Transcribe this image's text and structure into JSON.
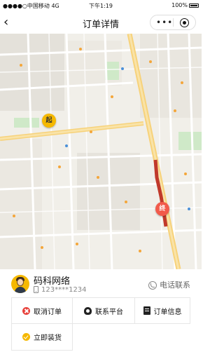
{
  "status_bar": {
    "carrier": "●●●●○中国移动",
    "network": "4G",
    "time": "下午1:19",
    "battery": "100%"
  },
  "nav": {
    "back_icon": "chevron-left-icon",
    "title": "订单详情",
    "more_icon": "more-dots-icon",
    "close_icon": "target-circle-icon"
  },
  "map": {
    "start_label": "起",
    "end_label": "终",
    "route_color": "#c0392b",
    "start_color": "#f5b800",
    "end_color": "#f25a4a"
  },
  "driver": {
    "name": "码科网络",
    "phone": "123****1234",
    "call_label": "电话联系"
  },
  "actions": [
    {
      "label": "取消订单",
      "icon": "cancel-icon",
      "color": "#e8413b"
    },
    {
      "label": "联系平台",
      "icon": "support-agent-icon"
    },
    {
      "label": "订单信息",
      "icon": "order-info-icon"
    },
    {
      "label": "立即装货",
      "icon": "confirm-load-icon",
      "color": "#f5b800"
    }
  ]
}
